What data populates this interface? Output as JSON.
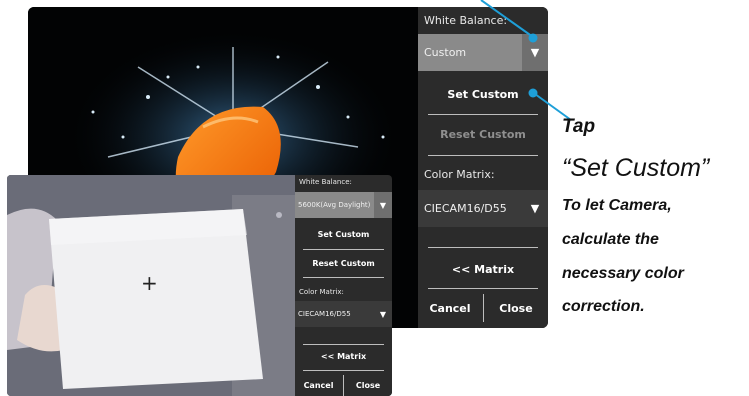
{
  "big_screen": {
    "panel": {
      "white_balance_label": "White Balance:",
      "white_balance_value": "Custom",
      "set_custom": "Set Custom",
      "reset_custom": "Reset Custom",
      "color_matrix_label": "Color Matrix:",
      "color_matrix_value": "CIECAM16/D55",
      "matrix_button": "<< Matrix",
      "cancel": "Cancel",
      "close": "Close"
    }
  },
  "small_screen": {
    "panel": {
      "white_balance_label": "White Balance:",
      "white_balance_value": "5600K(Avg Daylight)",
      "set_custom": "Set Custom",
      "reset_custom": "Reset Custom",
      "color_matrix_label": "Color Matrix:",
      "color_matrix_value": "CIECAM16/D55",
      "matrix_button": "<< Matrix",
      "cancel": "Cancel",
      "close": "Close"
    }
  },
  "annotation": {
    "line1": "Tap",
    "line2": "“Set Custom”",
    "line3": "To let Camera,",
    "line4": "calculate the",
    "line5": "necessary color",
    "line6": "correction."
  },
  "icons": {
    "dropdown": "▼",
    "crosshair": "+"
  },
  "colors": {
    "callout": "#1e9fd8",
    "panel": "#2b2b2b",
    "dropdown": "#8a8a8a"
  }
}
